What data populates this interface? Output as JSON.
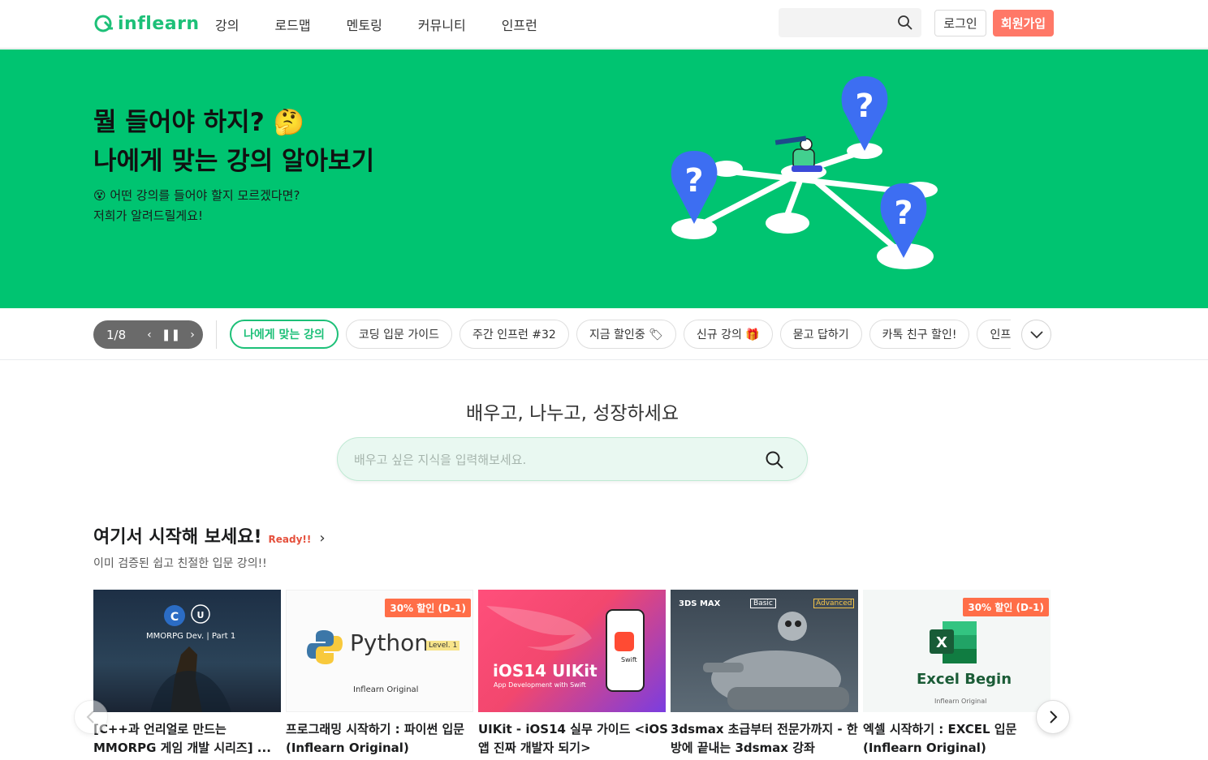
{
  "header": {
    "logo_text": "inflearn",
    "nav": [
      "강의",
      "로드맵",
      "멘토링",
      "커뮤니티",
      "인프런"
    ],
    "login_label": "로그인",
    "signup_label": "회원가입"
  },
  "hero": {
    "title_line1": "뭘 들어야 하지? 🤔",
    "title_line2": "나에게 맞는 강의 알아보기",
    "sub_line1": "😵 어떤 강의를 들어야 할지 모르겠다면?",
    "sub_line2": "저희가 알려드릴게요!",
    "bg_color": "#00c471"
  },
  "carousel": {
    "pager": "1/8",
    "chips": [
      "나에게 맞는 강의",
      "코딩 입문 가이드",
      "주간 인프런 #32",
      "지금 할인중 🏷",
      "신규 강의 🎁",
      "묻고 답하기",
      "카톡 친구 할인!",
      "인프런은"
    ]
  },
  "search": {
    "heading": "배우고, 나누고, 성장하세요",
    "placeholder": "배우고 싶은 지식을 입력해보세요."
  },
  "section": {
    "title": "여기서 시작해 보세요!",
    "badge": "Ready!!",
    "desc": "이미 검증된 쉽고 친절한 입문 강의!!"
  },
  "courses": [
    {
      "title": "[C++과 언리얼로 만드는 MMORPG 게임 개발 시리즈] ...",
      "thumb_line1": "MMORPG Dev. | Part 1",
      "discount": ""
    },
    {
      "title": "프로그래밍 시작하기 : 파이썬 입문 (Inflearn Original)",
      "thumb_line1": "Python",
      "thumb_level": "Level. 1",
      "thumb_line2": "Inflearn Original",
      "discount": "30% 할인 (D-1)"
    },
    {
      "title": "UIKit - iOS14 실무 가이드 <iOS 앱 진짜 개발자 되기>",
      "thumb_line1": "iOS14 UIKit",
      "thumb_line2": "App Development with Swift",
      "thumb_swift": "Swift",
      "discount": ""
    },
    {
      "title": "3dsmax 초급부터 전문가까지 - 한방에 끝내는 3dsmax 강좌",
      "thumb_line1": "3DS MAX",
      "thumb_basic": "Basic",
      "thumb_adv": "Advanced",
      "discount": ""
    },
    {
      "title": "엑셀 시작하기 : EXCEL 입문 (Inflearn Original)",
      "thumb_line1": "Excel Begin",
      "thumb_line2": "Inflearn Original",
      "discount": "30% 할인 (D-1)"
    }
  ]
}
